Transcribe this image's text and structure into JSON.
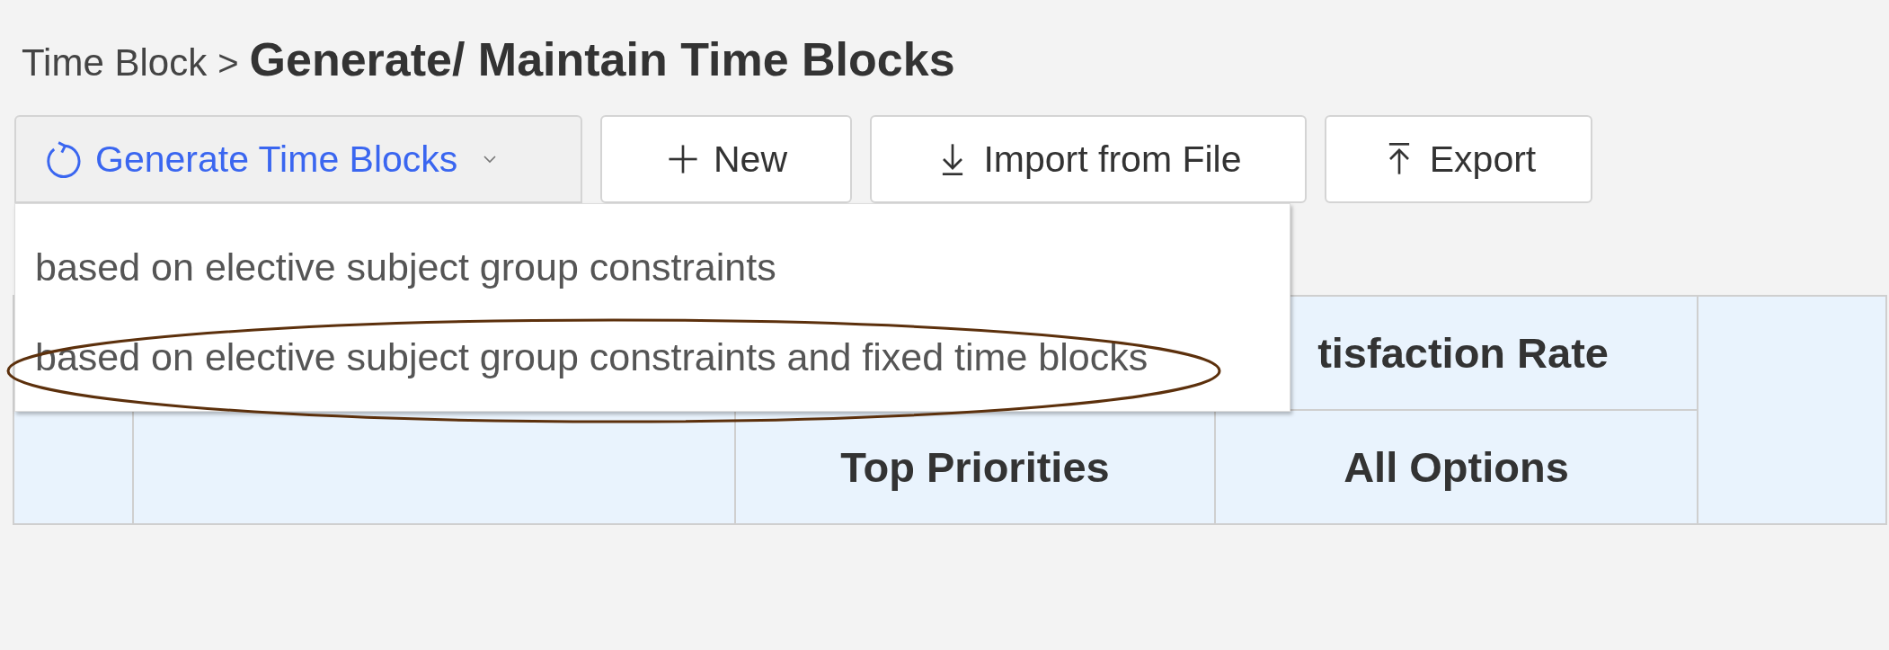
{
  "breadcrumb": {
    "parent": "Time Block",
    "separator": ">",
    "title": "Generate/ Maintain Time Blocks"
  },
  "toolbar": [
    {
      "label": "Generate Time Blocks",
      "kind": "dropdown",
      "expanded": true
    },
    {
      "label": "New",
      "kind": "button"
    },
    {
      "label": "Import from File",
      "kind": "button"
    },
    {
      "label": "Export",
      "kind": "button"
    }
  ],
  "menu": [
    {
      "label": "based on elective subject group constraints",
      "circled": false
    },
    {
      "label": "based on elective subject group constraints and fixed time blocks",
      "circled": true
    }
  ],
  "table": {
    "group_header": "tisfaction Rate",
    "columns": [
      "Top Priorities",
      "All Options"
    ]
  }
}
